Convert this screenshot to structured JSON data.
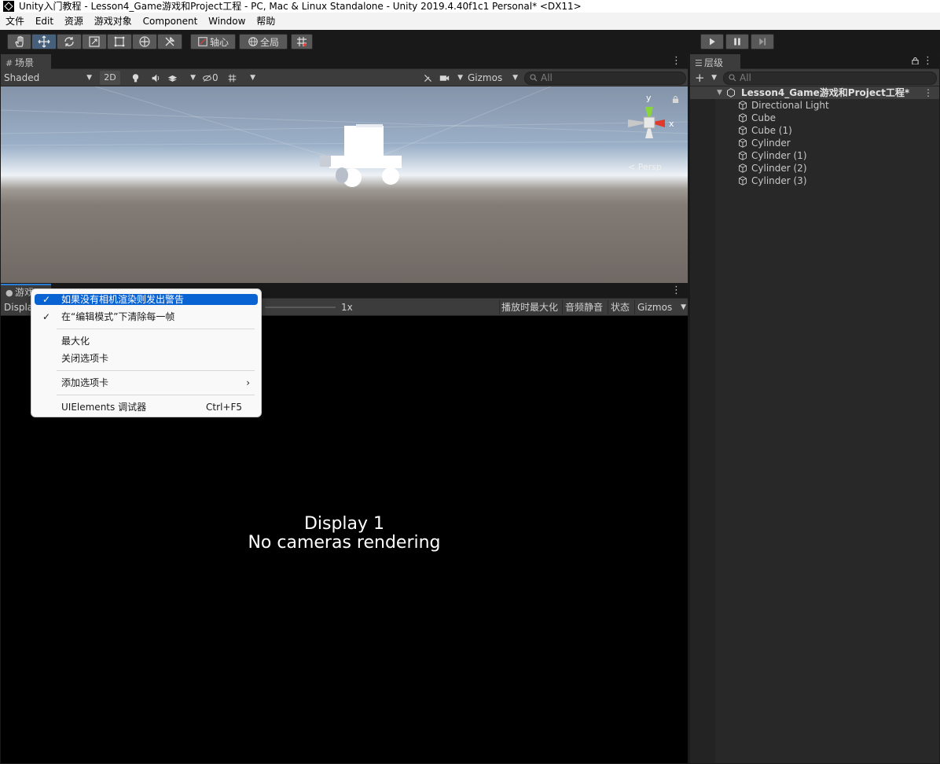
{
  "window": {
    "title": "Unity入门教程 - Lesson4_Game游戏和Project工程 - PC, Mac & Linux Standalone - Unity 2019.4.40f1c1 Personal* <DX11>"
  },
  "menubar": [
    "文件",
    "Edit",
    "资源",
    "游戏对象",
    "Component",
    "Window",
    "帮助"
  ],
  "toolbar": {
    "pivot_label": "轴心",
    "global_label": "全局"
  },
  "scene": {
    "tab_label": "场景",
    "shading_mode": "Shaded",
    "mode_2d": "2D",
    "hidden_count": "0",
    "gizmos_label": "Gizmos",
    "search_placeholder": "All",
    "persp_label": "< Persp",
    "axis_y": "y",
    "axis_x": "x"
  },
  "game": {
    "tab_label": "游戏",
    "display_label": "Displa",
    "scale_value": "1x",
    "maximize_on_play": "播放时最大化",
    "mute_audio": "音频静音",
    "stats": "状态",
    "gizmos_label": "Gizmos",
    "display_text": "Display 1",
    "no_camera_text": "No cameras rendering"
  },
  "context_menu": {
    "items": [
      {
        "label": "如果没有相机渲染则发出警告",
        "checked": true
      },
      {
        "label": "在“编辑模式”下清除每一帧",
        "checked": true
      },
      {
        "label": "最大化"
      },
      {
        "label": "关闭选项卡"
      },
      {
        "label": "添加选项卡",
        "submenu_arrow": "›"
      },
      {
        "label": "UIElements 调试器",
        "shortcut": "Ctrl+F5"
      }
    ],
    "check_glyph": "✓"
  },
  "hierarchy": {
    "tab_label": "层级",
    "add_label": "+",
    "search_placeholder": "All",
    "scene_name": "Lesson4_Game游戏和Project工程*",
    "items": [
      "Directional Light",
      "Cube",
      "Cube (1)",
      "Cylinder",
      "Cylinder (1)",
      "Cylinder (2)",
      "Cylinder (3)"
    ]
  },
  "colors": {
    "accent": "#2b7ed6",
    "selection": "#0a63d3",
    "panel_bg": "#282828",
    "game_bg": "#000000"
  }
}
